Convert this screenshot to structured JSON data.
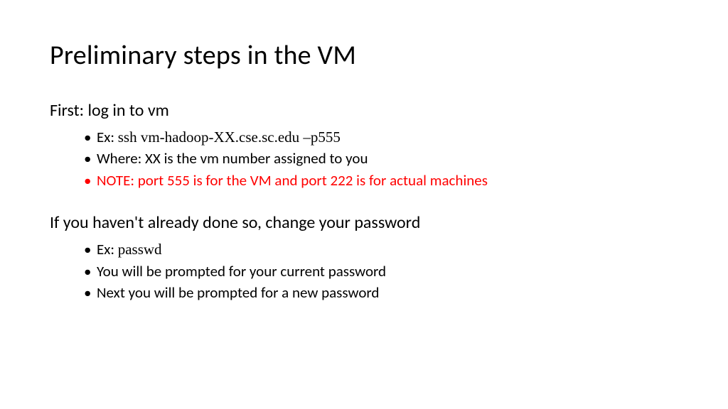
{
  "title": "Preliminary steps in the VM",
  "section1": {
    "heading": "First: log in to vm",
    "bullets": {
      "b1_prefix": "Ex: ",
      "b1_code": "ssh vm-hadoop-XX.cse.sc.edu –p555",
      "b2": "Where: XX is the vm number assigned to you",
      "b3": "NOTE: port 555 is for the VM and port 222 is for actual machines"
    }
  },
  "section2": {
    "heading": "If you haven't already done so, change your password",
    "bullets": {
      "b1_prefix": "Ex: ",
      "b1_code": "passwd",
      "b2": "You will be prompted for your current password",
      "b3": "Next you will be prompted for a new password"
    }
  }
}
